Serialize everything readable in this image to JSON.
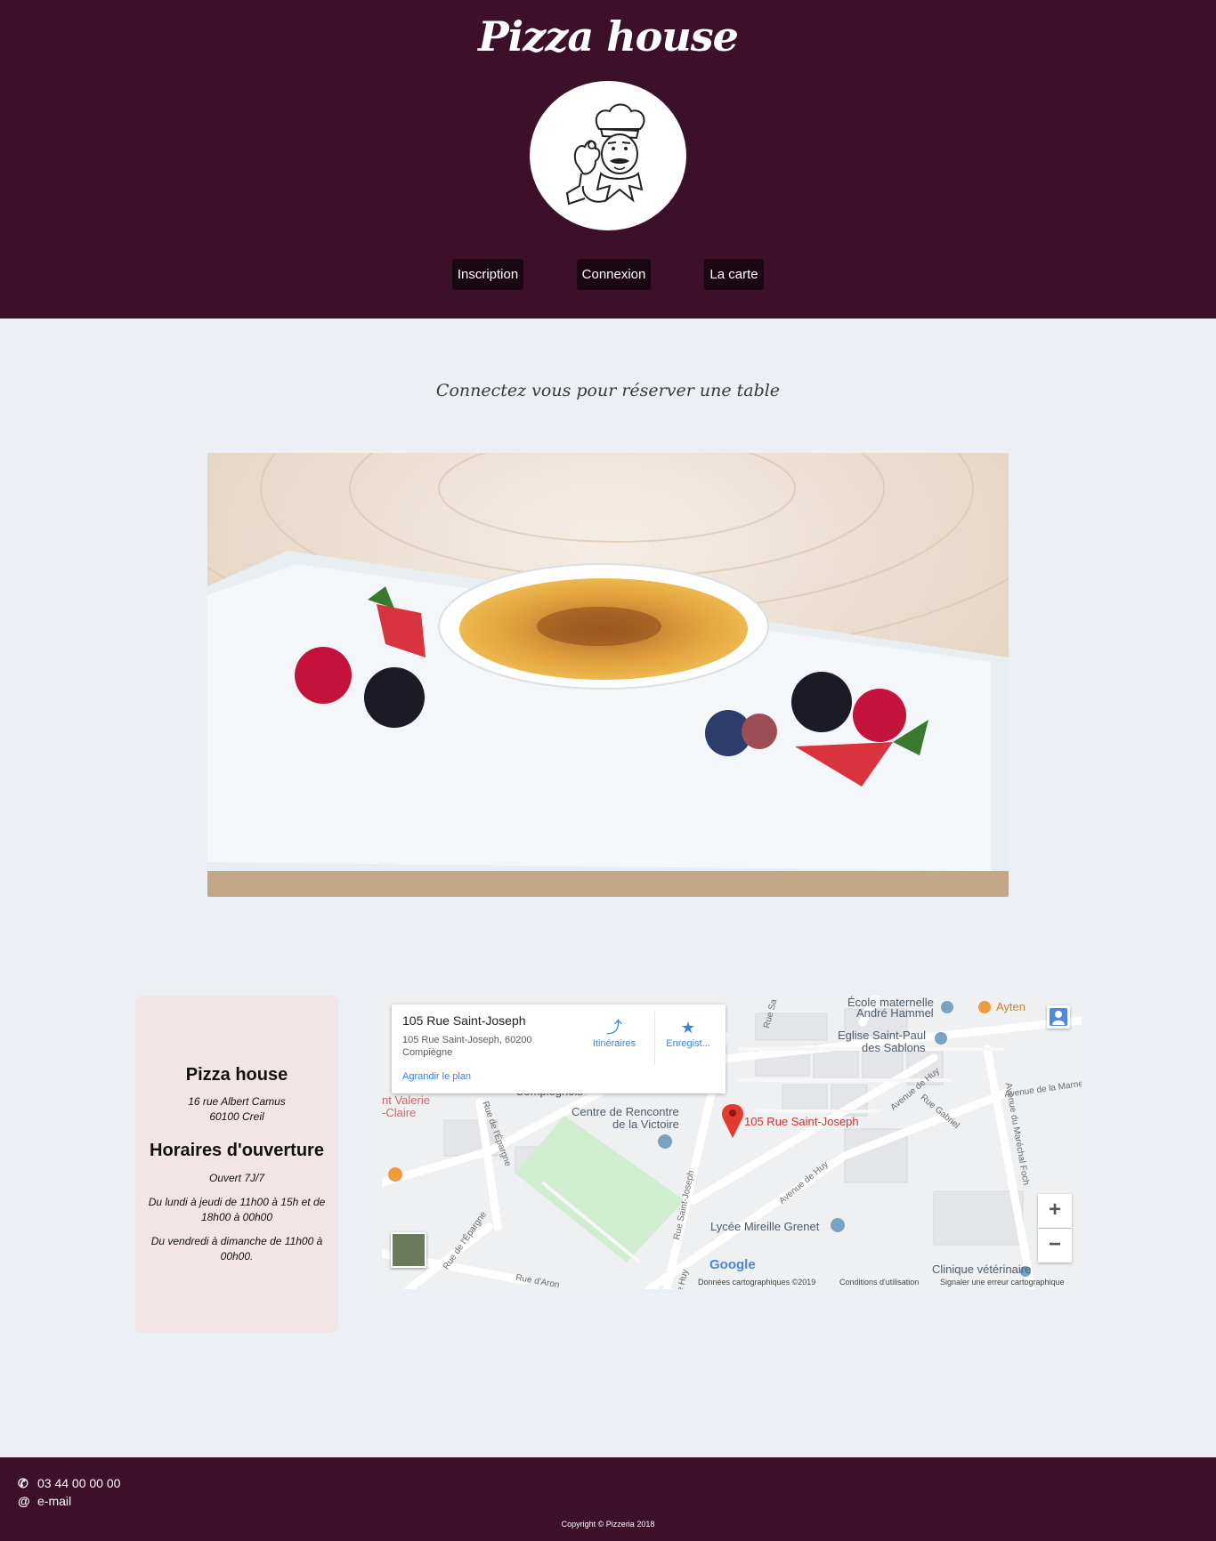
{
  "header": {
    "title": "Pizza house",
    "nav": [
      {
        "label": "Inscription"
      },
      {
        "label": "Connexion"
      },
      {
        "label": "La carte"
      }
    ]
  },
  "main": {
    "tagline": "Connectez vous pour réserver une table"
  },
  "info": {
    "name": "Pizza house",
    "address_line1": "16 rue Albert Camus",
    "address_line2": "60100 Creil",
    "hours_title": "Horaires d'ouverture",
    "open": "Ouvert 7J/7",
    "schedule_weekdays": "Du lundi à jeudi de 11h00 à 15h et de 18h00 à 00h00",
    "schedule_weekend": "Du vendredi à dimanche de 11h00 à 00h00."
  },
  "map": {
    "place_title": "105 Rue Saint-Joseph",
    "place_address": "105 Rue Saint-Joseph, 60200 Compiègne",
    "directions_label": "Itinéraires",
    "save_label": "Enregist...",
    "enlarge_label": "Agrandir le plan",
    "pin_label": "105 Rue Saint-Joseph",
    "zoom_in": "+",
    "zoom_out": "−",
    "google": "Google",
    "attribution_data": "Données cartographiques ©2019",
    "attribution_terms": "Conditions d'utilisation",
    "attribution_report": "Signaler une erreur cartographique",
    "labels": [
      {
        "text": "École maternelle"
      },
      {
        "text": "André Hammel"
      },
      {
        "text": "Ayten"
      },
      {
        "text": "Eglise Saint-Paul"
      },
      {
        "text": "des Sablons"
      },
      {
        "text": "Centre de Rencontre"
      },
      {
        "text": "de la Victoire"
      },
      {
        "text": "Lycée Mireille Grenet"
      },
      {
        "text": "Clinique vétérinaire"
      },
      {
        "text": "nt Valerie"
      },
      {
        "text": "-Claire"
      },
      {
        "text": "Compiègnois"
      },
      {
        "text": "Avenue de Huy"
      },
      {
        "text": "Avenue de Huy"
      },
      {
        "text": "Rue Saint-Joseph"
      },
      {
        "text": "Avenue du Maréchal Foch"
      },
      {
        "text": "Avenue de la Marne"
      },
      {
        "text": "Rue Gabriel"
      },
      {
        "text": "Rue de l'Épargne"
      },
      {
        "text": "Rue de l'Épargne"
      },
      {
        "text": "Rue d'Aron"
      },
      {
        "text": "Rue Sa"
      },
      {
        "text": "e Huy"
      }
    ]
  },
  "footer": {
    "phone": "03 44 00 00 00",
    "email": "e-mail",
    "copyright": "Copyright © Pizzeria 2018"
  },
  "colors": {
    "brand": "#3d1029",
    "nav_bg": "#1a0711",
    "page_bg": "#eceff3",
    "card_bg": "#f2e5e6",
    "link_blue": "#3a84df",
    "pin_red": "#c9362f"
  }
}
